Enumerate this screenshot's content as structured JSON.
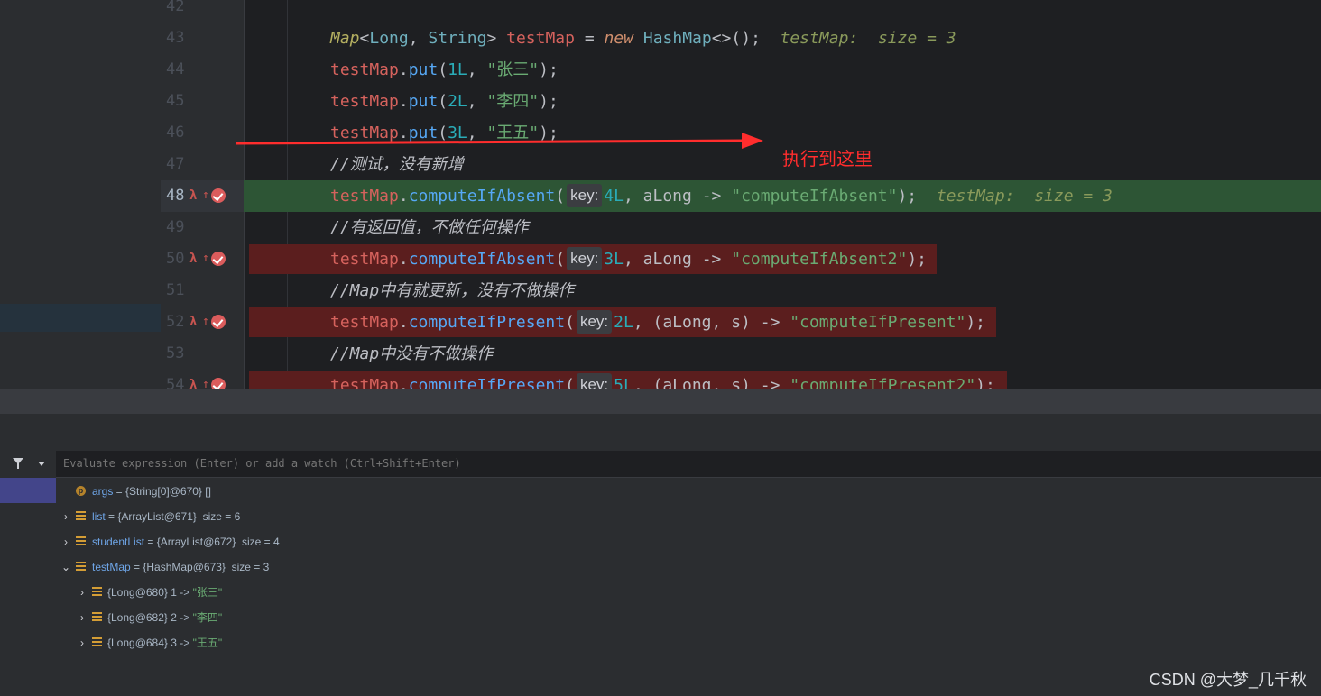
{
  "editor": {
    "lines": [
      {
        "num": "42"
      },
      {
        "num": "43"
      },
      {
        "num": "44"
      },
      {
        "num": "45"
      },
      {
        "num": "46"
      },
      {
        "num": "47"
      },
      {
        "num": "48"
      },
      {
        "num": "49"
      },
      {
        "num": "50"
      },
      {
        "num": "51"
      },
      {
        "num": "52"
      },
      {
        "num": "53"
      },
      {
        "num": "54"
      }
    ],
    "tokens": {
      "map_type": "Map",
      "long_type": "Long",
      "string_type": "String",
      "test_map": "testMap",
      "new_kw": "new",
      "hashmap": "HashMap",
      "put": "put",
      "compute_if_absent": "computeIfAbsent",
      "compute_if_present": "computeIfPresent",
      "one_l": "1L",
      "two_l": "2L",
      "three_l": "3L",
      "four_l": "4L",
      "five_l": "5L",
      "zhang_san": "\"张三\"",
      "li_si": "\"李四\"",
      "wang_wu": "\"王五\"",
      "along": "aLong",
      "s": "s",
      "arrow_op": "->",
      "str_cia": "\"computeIfAbsent\"",
      "str_cia2": "\"computeIfAbsent2\"",
      "str_cip": "\"computeIfPresent\"",
      "str_cip2": "\"computeIfPresent2\"",
      "hint_key": "key:",
      "comment_47": "//测试，没有新增",
      "comment_49": "//有返回值，不做任何操作",
      "comment_51": "//Map中有就更新，没有不做操作",
      "comment_53": "//Map中没有不做操作",
      "debug_43": "testMap:  size = 3",
      "debug_48": "testMap:  size = 3"
    }
  },
  "annotation": {
    "text": "执行到这里",
    "color": "#ff2d2d"
  },
  "debugger": {
    "eval_placeholder": "Evaluate expression (Enter) or add a watch (Ctrl+Shift+Enter)",
    "variables": [
      {
        "icon": "p",
        "name": "args",
        "value": " = {String[0]@670} []"
      },
      {
        "icon": "f",
        "name": "list",
        "value": " = {ArrayList@671}  size = 6"
      },
      {
        "icon": "f",
        "name": "studentList",
        "value": " = {ArrayList@672}  size = 4"
      },
      {
        "icon": "f",
        "name": "testMap",
        "value": " = {HashMap@673}  size = 3"
      }
    ],
    "entries": [
      {
        "key": "{Long@680} 1 -> ",
        "value": "\"张三\""
      },
      {
        "key": "{Long@682} 2 -> ",
        "value": "\"李四\""
      },
      {
        "key": "{Long@684} 3 -> ",
        "value": "\"王五\""
      }
    ]
  },
  "watermark": "CSDN @大梦_几千秋",
  "colors": {
    "editor_bg": "#1e1f22",
    "exec_line": "#2d5535",
    "breakpoint_line": "#5b1e1e",
    "panel_bg": "#2b2d30"
  }
}
